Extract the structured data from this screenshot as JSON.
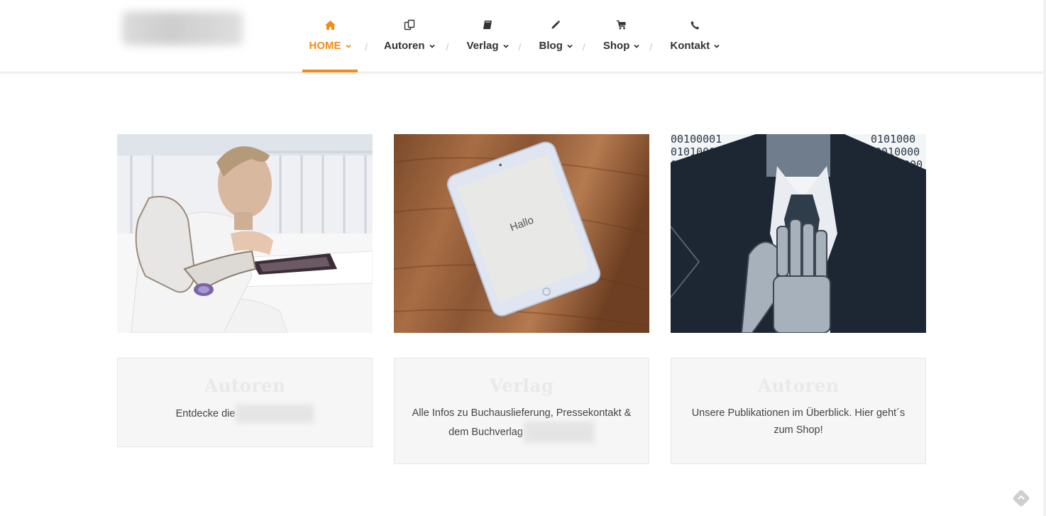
{
  "nav": {
    "items": [
      {
        "label": "HOME",
        "icon": "home-icon",
        "active": true
      },
      {
        "label": "Autoren",
        "icon": "copy-icon",
        "active": false
      },
      {
        "label": "Verlag",
        "icon": "book-icon",
        "active": false
      },
      {
        "label": "Blog",
        "icon": "pencil-icon",
        "active": false
      },
      {
        "label": "Shop",
        "icon": "cart-icon",
        "active": false
      },
      {
        "label": "Kontakt",
        "icon": "phone-icon",
        "active": false
      }
    ],
    "separator": "/"
  },
  "colors": {
    "accent": "#f28c18",
    "text": "#333333",
    "card_bg": "#f6f6f6"
  },
  "cards": [
    {
      "title": "Autoren",
      "text": "Entdecke die",
      "image": "robot-arm-boy-image"
    },
    {
      "title": "Verlag",
      "text_line1": "Alle Infos zu Buchauslieferung, Pressekontakt &",
      "text_line2": "dem Buchverlag",
      "image": "tablet-hallo-image",
      "tablet_text": "Hallo"
    },
    {
      "title": "Autoren",
      "text_line1": "Unsere Publikationen im Überblick. Hier geht´s",
      "text_line2": "zum Shop!",
      "image": "robot-hand-suit-image",
      "binary_rows": [
        "00100001",
        "0101000",
        "0101000",
        "0010000"
      ]
    }
  ]
}
